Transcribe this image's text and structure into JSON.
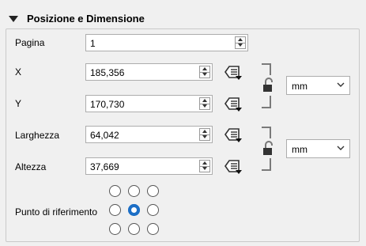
{
  "group": {
    "title": "Posizione e Dimensione"
  },
  "fields": {
    "page": {
      "label": "Pagina",
      "value": "1"
    },
    "x": {
      "label": "X",
      "value": "185,356"
    },
    "y": {
      "label": "Y",
      "value": "170,730"
    },
    "width": {
      "label": "Larghezza",
      "value": "64,042"
    },
    "height": {
      "label": "Altezza",
      "value": "37,669"
    }
  },
  "position_units": {
    "selected": "mm"
  },
  "size_units": {
    "selected": "mm"
  },
  "reference_point": {
    "label": "Punto di riferimento",
    "selected": "middle-center"
  }
}
